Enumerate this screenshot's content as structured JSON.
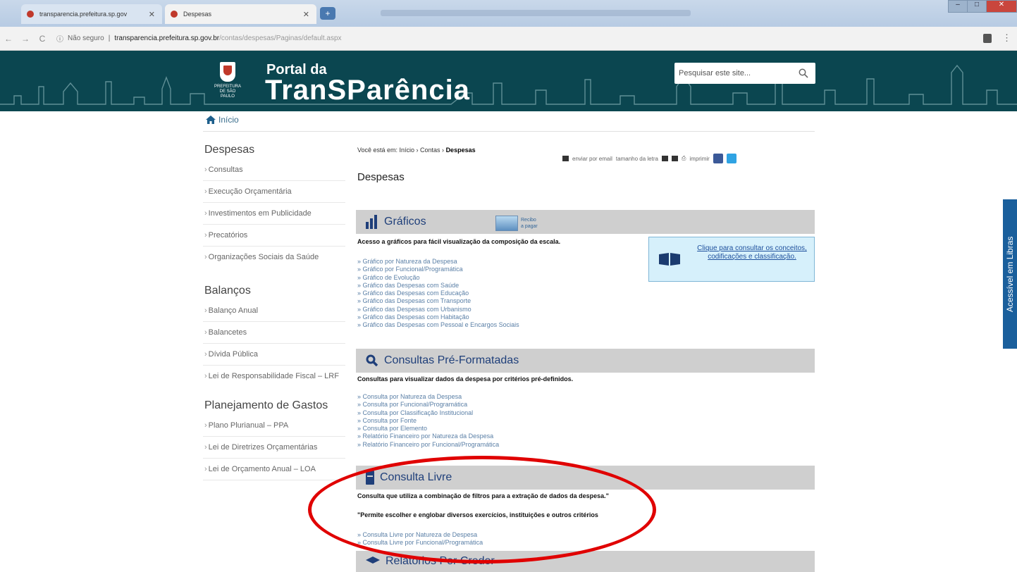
{
  "browser": {
    "tabs": [
      {
        "label": "transparencia.prefeitura.sp.gov",
        "active": false
      },
      {
        "label": "Despesas",
        "active": true
      }
    ],
    "new_tab_label": "+",
    "security": "Não seguro",
    "url_host": "transparencia.prefeitura.sp.gov.br",
    "url_path": "/contas/despesas/Paginas/default.aspx"
  },
  "header": {
    "crest_text": "PREFEITURA DE SÃO PAULO",
    "portal_small": "Portal da",
    "portal_big": "TranSParência",
    "search_placeholder": "Pesquisar este site..."
  },
  "home_label": "Início",
  "sidebar": {
    "groups": [
      {
        "title": "Despesas",
        "items": [
          "Consultas",
          "Execução Orçamentária",
          "Investimentos em Publicidade",
          "Precatórios",
          "Organizações Sociais da Saúde"
        ]
      },
      {
        "title": "Balanços",
        "items": [
          "Balanço Anual",
          "Balancetes",
          "Dívida Pública",
          "Lei de Responsabilidade Fiscal – LRF"
        ]
      },
      {
        "title": "Planejamento de Gastos",
        "items": [
          "Plano Plurianual – PPA",
          "Lei de Diretrizes Orçamentárias",
          "Lei de Orçamento Anual – LOA"
        ]
      }
    ]
  },
  "breadcrumb": {
    "prefix": "Você está em: Início › Contas › ",
    "current": "Despesas"
  },
  "tools": {
    "email": "enviar por email",
    "font_size": "tamanho da letra",
    "print": "imprimir"
  },
  "page_title": "Despesas",
  "raster_link": {
    "line1": "Recibo",
    "line2": "a pagar"
  },
  "info_box": {
    "text": "Clique para consultar os conceitos, codificações e classificação."
  },
  "sections": {
    "graficos": {
      "title": "Gráficos",
      "desc": "Acesso a gráficos para fácil visualização da composição da escala.",
      "links": [
        "Gráfico por Natureza da Despesa",
        "Gráfico por Funcional/Programática",
        "Gráfico de Evolução",
        "Gráfico das Despesas com Saúde",
        "Gráfico das Despesas com Educação",
        "Gráfico das Despesas com Transporte",
        "Gráfico das Despesas com Urbanismo",
        "Gráfico das Despesas com Habitação",
        "Gráfico das Despesas com Pessoal e Encargos Sociais"
      ]
    },
    "consultas": {
      "title": "Consultas Pré-Formatadas",
      "desc": "Consultas para visualizar dados da despesa por critérios pré-definidos.",
      "links": [
        "Consulta por Natureza da Despesa",
        "Consulta por Funcional/Programática",
        "Consulta por Classificação Institucional",
        "Consulta por Fonte",
        "Consulta por Elemento",
        "Relatório Financeiro por Natureza da Despesa",
        "Relatório Financeiro por Funcional/Programática"
      ]
    },
    "livre": {
      "title": "Consulta Livre",
      "desc": "Consulta que utiliza a combinação de filtros para a extração de dados da despesa.\"",
      "note": "\"Permite escolher e englobar diversos exercícios, instituições e outros critérios",
      "links": [
        "Consulta Livre por Natureza de Despesa",
        "Consulta Livre por Funcional/Programática"
      ]
    },
    "relatorios": {
      "title": "Relatórios Por Credor"
    }
  },
  "libras_label": "Acessível em Libras",
  "colors": {
    "header_bg": "#0b4650",
    "section_bg": "#cfcfcf",
    "link": "#5a7fa6",
    "highlight": "#e00000"
  }
}
